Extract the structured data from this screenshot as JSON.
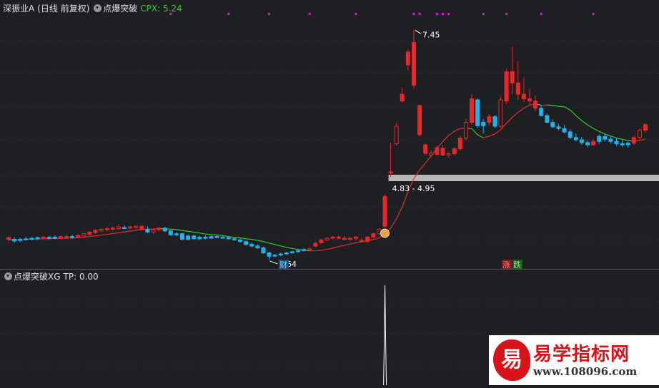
{
  "main_header": {
    "stock_name": "深振业A",
    "period": "(日线 前复权)",
    "indicator_name": "点爆突破",
    "indicator_value": "CPX: 5.24"
  },
  "sub_header": {
    "indicator_name": "点爆突破XG",
    "indicator_value": "TP: 0.00"
  },
  "annotations": {
    "high_label": "7.45",
    "low_label": "3.64",
    "range_label": "4.83 - 4.95",
    "cai_badge": "财",
    "zhang_badge": "涨",
    "die_badge": "跌"
  },
  "watermark": {
    "logo_char": "易",
    "title": "易学指标网",
    "url": "www.108096.com"
  },
  "colors": {
    "background": "#1e1f22",
    "up": "#e8262c",
    "down": "#21b1ec",
    "ma_up": "#e03030",
    "ma_down": "#33cc33",
    "signal_dot": "#d020d0",
    "grid": "#2e3035",
    "band": "#b8b8b8",
    "indicator_green": "#33cc33"
  },
  "chart_data": {
    "type": "candlestick",
    "price_range_visible": [
      3.2,
      7.7
    ],
    "grid": true,
    "candles": [
      {
        "o": 3.75,
        "h": 3.78,
        "l": 3.68,
        "c": 3.72,
        "d": "up"
      },
      {
        "o": 3.72,
        "h": 3.76,
        "l": 3.66,
        "c": 3.69,
        "d": "down"
      },
      {
        "o": 3.7,
        "h": 3.75,
        "l": 3.67,
        "c": 3.72,
        "d": "down"
      },
      {
        "o": 3.72,
        "h": 3.76,
        "l": 3.7,
        "c": 3.73,
        "d": "down"
      },
      {
        "o": 3.73,
        "h": 3.76,
        "l": 3.7,
        "c": 3.74,
        "d": "down"
      },
      {
        "o": 3.74,
        "h": 3.77,
        "l": 3.71,
        "c": 3.75,
        "d": "down"
      },
      {
        "o": 3.75,
        "h": 3.78,
        "l": 3.72,
        "c": 3.76,
        "d": "up"
      },
      {
        "o": 3.74,
        "h": 3.78,
        "l": 3.71,
        "c": 3.76,
        "d": "down"
      },
      {
        "o": 3.76,
        "h": 3.79,
        "l": 3.72,
        "c": 3.74,
        "d": "down"
      },
      {
        "o": 3.74,
        "h": 3.79,
        "l": 3.72,
        "c": 3.77,
        "d": "up"
      },
      {
        "o": 3.77,
        "h": 3.8,
        "l": 3.74,
        "c": 3.76,
        "d": "up"
      },
      {
        "o": 3.76,
        "h": 3.8,
        "l": 3.73,
        "c": 3.77,
        "d": "down"
      },
      {
        "o": 3.76,
        "h": 3.81,
        "l": 3.74,
        "c": 3.79,
        "d": "up"
      },
      {
        "o": 3.78,
        "h": 3.84,
        "l": 3.76,
        "c": 3.82,
        "d": "up"
      },
      {
        "o": 3.81,
        "h": 3.86,
        "l": 3.79,
        "c": 3.85,
        "d": "up"
      },
      {
        "o": 3.84,
        "h": 3.9,
        "l": 3.82,
        "c": 3.88,
        "d": "up"
      },
      {
        "o": 3.87,
        "h": 3.92,
        "l": 3.85,
        "c": 3.9,
        "d": "up"
      },
      {
        "o": 3.89,
        "h": 3.94,
        "l": 3.86,
        "c": 3.91,
        "d": "up"
      },
      {
        "o": 3.9,
        "h": 3.95,
        "l": 3.87,
        "c": 3.92,
        "d": "up"
      },
      {
        "o": 3.91,
        "h": 3.99,
        "l": 3.89,
        "c": 3.94,
        "d": "up"
      },
      {
        "o": 3.93,
        "h": 3.97,
        "l": 3.9,
        "c": 3.92,
        "d": "down"
      },
      {
        "o": 3.92,
        "h": 3.96,
        "l": 3.89,
        "c": 3.94,
        "d": "up"
      },
      {
        "o": 3.93,
        "h": 3.97,
        "l": 3.9,
        "c": 3.95,
        "d": "up"
      },
      {
        "o": 3.95,
        "h": 3.97,
        "l": 3.88,
        "c": 3.9,
        "d": "up"
      },
      {
        "o": 3.9,
        "h": 3.95,
        "l": 3.83,
        "c": 3.85,
        "d": "down"
      },
      {
        "o": 3.85,
        "h": 3.91,
        "l": 3.82,
        "c": 3.89,
        "d": "up"
      },
      {
        "o": 3.89,
        "h": 3.94,
        "l": 3.86,
        "c": 3.92,
        "d": "up"
      },
      {
        "o": 3.92,
        "h": 3.94,
        "l": 3.85,
        "c": 3.87,
        "d": "down"
      },
      {
        "o": 3.87,
        "h": 3.9,
        "l": 3.78,
        "c": 3.8,
        "d": "down"
      },
      {
        "o": 3.8,
        "h": 3.85,
        "l": 3.77,
        "c": 3.82,
        "d": "down"
      },
      {
        "o": 3.82,
        "h": 3.84,
        "l": 3.7,
        "c": 3.72,
        "d": "down"
      },
      {
        "o": 3.72,
        "h": 3.8,
        "l": 3.7,
        "c": 3.78,
        "d": "down"
      },
      {
        "o": 3.78,
        "h": 3.8,
        "l": 3.71,
        "c": 3.73,
        "d": "down"
      },
      {
        "o": 3.73,
        "h": 3.78,
        "l": 3.71,
        "c": 3.76,
        "d": "down"
      },
      {
        "o": 3.76,
        "h": 3.79,
        "l": 3.72,
        "c": 3.74,
        "d": "down"
      },
      {
        "o": 3.74,
        "h": 3.79,
        "l": 3.73,
        "c": 3.77,
        "d": "down"
      },
      {
        "o": 3.77,
        "h": 3.8,
        "l": 3.74,
        "c": 3.76,
        "d": "down"
      },
      {
        "o": 3.76,
        "h": 3.79,
        "l": 3.73,
        "c": 3.75,
        "d": "down"
      },
      {
        "o": 3.75,
        "h": 3.77,
        "l": 3.71,
        "c": 3.73,
        "d": "down"
      },
      {
        "o": 3.73,
        "h": 3.76,
        "l": 3.69,
        "c": 3.71,
        "d": "down"
      },
      {
        "o": 3.71,
        "h": 3.74,
        "l": 3.66,
        "c": 3.68,
        "d": "down"
      },
      {
        "o": 3.68,
        "h": 3.7,
        "l": 3.61,
        "c": 3.63,
        "d": "down"
      },
      {
        "o": 3.63,
        "h": 3.66,
        "l": 3.58,
        "c": 3.6,
        "d": "down"
      },
      {
        "o": 3.6,
        "h": 3.63,
        "l": 3.55,
        "c": 3.57,
        "d": "down"
      },
      {
        "o": 3.57,
        "h": 3.59,
        "l": 3.46,
        "c": 3.48,
        "d": "down"
      },
      {
        "o": 3.48,
        "h": 3.5,
        "l": 3.36,
        "c": 3.42,
        "d": "down"
      },
      {
        "o": 3.42,
        "h": 3.46,
        "l": 3.4,
        "c": 3.44,
        "d": "down"
      },
      {
        "o": 3.44,
        "h": 3.48,
        "l": 3.42,
        "c": 3.46,
        "d": "down"
      },
      {
        "o": 3.46,
        "h": 3.5,
        "l": 3.44,
        "c": 3.48,
        "d": "down"
      },
      {
        "o": 3.48,
        "h": 3.52,
        "l": 3.46,
        "c": 3.5,
        "d": "down"
      },
      {
        "o": 3.5,
        "h": 3.54,
        "l": 3.48,
        "c": 3.52,
        "d": "down"
      },
      {
        "o": 3.52,
        "h": 3.56,
        "l": 3.5,
        "c": 3.54,
        "d": "down"
      },
      {
        "o": 3.54,
        "h": 3.58,
        "l": 3.52,
        "c": 3.55,
        "d": "up"
      },
      {
        "o": 3.6,
        "h": 3.68,
        "l": 3.58,
        "c": 3.65,
        "d": "up"
      },
      {
        "o": 3.66,
        "h": 3.73,
        "l": 3.64,
        "c": 3.71,
        "d": "up"
      },
      {
        "o": 3.71,
        "h": 3.76,
        "l": 3.69,
        "c": 3.74,
        "d": "up"
      },
      {
        "o": 3.74,
        "h": 3.78,
        "l": 3.71,
        "c": 3.76,
        "d": "up"
      },
      {
        "o": 3.76,
        "h": 3.79,
        "l": 3.72,
        "c": 3.74,
        "d": "up"
      },
      {
        "o": 3.74,
        "h": 3.78,
        "l": 3.7,
        "c": 3.72,
        "d": "up"
      },
      {
        "o": 3.72,
        "h": 3.76,
        "l": 3.69,
        "c": 3.74,
        "d": "up"
      },
      {
        "o": 3.74,
        "h": 3.78,
        "l": 3.71,
        "c": 3.76,
        "d": "up"
      },
      {
        "o": 3.7,
        "h": 3.74,
        "l": 3.66,
        "c": 3.68,
        "d": "up"
      },
      {
        "o": 3.68,
        "h": 3.78,
        "l": 3.66,
        "c": 3.76,
        "d": "up"
      },
      {
        "o": 3.76,
        "h": 3.84,
        "l": 3.74,
        "c": 3.82,
        "d": "up"
      },
      {
        "o": 3.82,
        "h": 3.92,
        "l": 3.8,
        "c": 3.9,
        "d": "up"
      },
      {
        "o": 3.95,
        "h": 4.52,
        "l": 3.93,
        "c": 4.48,
        "d": "up"
      },
      {
        "o": 4.9,
        "h": 5.44,
        "l": 4.83,
        "c": 4.92,
        "d": "up"
      },
      {
        "o": 5.42,
        "h": 5.8,
        "l": 5.38,
        "c": 5.73,
        "d": "up"
      },
      {
        "o": 6.18,
        "h": 6.42,
        "l": 6.15,
        "c": 6.3,
        "d": "up"
      },
      {
        "o": 6.82,
        "h": 7.1,
        "l": 6.72,
        "c": 7.05,
        "d": "up"
      },
      {
        "o": 7.22,
        "h": 7.45,
        "l": 6.4,
        "c": 6.46,
        "d": "up"
      },
      {
        "o": 6.1,
        "h": 6.12,
        "l": 5.55,
        "c": 5.58,
        "d": "up"
      },
      {
        "o": 5.4,
        "h": 5.42,
        "l": 5.22,
        "c": 5.25,
        "d": "up"
      },
      {
        "o": 5.22,
        "h": 5.3,
        "l": 5.18,
        "c": 5.25,
        "d": "up"
      },
      {
        "o": 5.23,
        "h": 5.38,
        "l": 5.2,
        "c": 5.35,
        "d": "up"
      },
      {
        "o": 5.34,
        "h": 5.4,
        "l": 5.2,
        "c": 5.22,
        "d": "up"
      },
      {
        "o": 5.22,
        "h": 5.28,
        "l": 5.17,
        "c": 5.24,
        "d": "up"
      },
      {
        "o": 5.24,
        "h": 5.36,
        "l": 5.21,
        "c": 5.33,
        "d": "up"
      },
      {
        "o": 5.33,
        "h": 5.56,
        "l": 5.3,
        "c": 5.52,
        "d": "up"
      },
      {
        "o": 5.52,
        "h": 5.86,
        "l": 5.48,
        "c": 5.8,
        "d": "up"
      },
      {
        "o": 5.8,
        "h": 6.3,
        "l": 5.76,
        "c": 6.22,
        "d": "up"
      },
      {
        "o": 6.2,
        "h": 6.23,
        "l": 5.7,
        "c": 5.74,
        "d": "down"
      },
      {
        "o": 5.74,
        "h": 5.86,
        "l": 5.6,
        "c": 5.8,
        "d": "down"
      },
      {
        "o": 5.8,
        "h": 5.95,
        "l": 5.74,
        "c": 5.9,
        "d": "up"
      },
      {
        "o": 5.9,
        "h": 5.93,
        "l": 5.7,
        "c": 5.73,
        "d": "down"
      },
      {
        "o": 5.73,
        "h": 6.26,
        "l": 5.7,
        "c": 6.2,
        "d": "up"
      },
      {
        "o": 6.18,
        "h": 6.75,
        "l": 6.12,
        "c": 6.7,
        "d": "up"
      },
      {
        "o": 6.7,
        "h": 7.15,
        "l": 6.3,
        "c": 6.5,
        "d": "up"
      },
      {
        "o": 6.5,
        "h": 6.88,
        "l": 6.2,
        "c": 6.3,
        "d": "up"
      },
      {
        "o": 6.3,
        "h": 6.6,
        "l": 6.16,
        "c": 6.22,
        "d": "up"
      },
      {
        "o": 6.22,
        "h": 6.4,
        "l": 6.1,
        "c": 6.18,
        "d": "up"
      },
      {
        "o": 6.18,
        "h": 6.28,
        "l": 6.0,
        "c": 6.05,
        "d": "up"
      },
      {
        "o": 6.05,
        "h": 6.1,
        "l": 5.9,
        "c": 5.92,
        "d": "down"
      },
      {
        "o": 5.92,
        "h": 5.96,
        "l": 5.78,
        "c": 5.8,
        "d": "down"
      },
      {
        "o": 5.8,
        "h": 5.85,
        "l": 5.7,
        "c": 5.72,
        "d": "down"
      },
      {
        "o": 5.72,
        "h": 5.78,
        "l": 5.66,
        "c": 5.69,
        "d": "down"
      },
      {
        "o": 5.69,
        "h": 5.76,
        "l": 5.6,
        "c": 5.63,
        "d": "down"
      },
      {
        "o": 5.63,
        "h": 5.68,
        "l": 5.5,
        "c": 5.53,
        "d": "down"
      },
      {
        "o": 5.53,
        "h": 5.6,
        "l": 5.46,
        "c": 5.49,
        "d": "down"
      },
      {
        "o": 5.49,
        "h": 5.54,
        "l": 5.4,
        "c": 5.44,
        "d": "down"
      },
      {
        "o": 5.44,
        "h": 5.48,
        "l": 5.36,
        "c": 5.4,
        "d": "down"
      },
      {
        "o": 5.4,
        "h": 5.5,
        "l": 5.38,
        "c": 5.46,
        "d": "up"
      },
      {
        "o": 5.46,
        "h": 5.58,
        "l": 5.42,
        "c": 5.55,
        "d": "down"
      },
      {
        "o": 5.55,
        "h": 5.6,
        "l": 5.46,
        "c": 5.5,
        "d": "down"
      },
      {
        "o": 5.5,
        "h": 5.55,
        "l": 5.42,
        "c": 5.46,
        "d": "down"
      },
      {
        "o": 5.46,
        "h": 5.52,
        "l": 5.38,
        "c": 5.42,
        "d": "down"
      },
      {
        "o": 5.42,
        "h": 5.48,
        "l": 5.36,
        "c": 5.4,
        "d": "down"
      },
      {
        "o": 5.4,
        "h": 5.46,
        "l": 5.35,
        "c": 5.43,
        "d": "down"
      },
      {
        "o": 5.43,
        "h": 5.56,
        "l": 5.4,
        "c": 5.53,
        "d": "up"
      },
      {
        "o": 5.53,
        "h": 5.7,
        "l": 5.5,
        "c": 5.66,
        "d": "up"
      },
      {
        "o": 5.66,
        "h": 5.78,
        "l": 5.62,
        "c": 5.76,
        "d": "up"
      }
    ],
    "signal_dot_indices": [
      28,
      38,
      45,
      52,
      60,
      70,
      71,
      74,
      75,
      76,
      82,
      86,
      92,
      101
    ]
  },
  "sub_chart_data": {
    "type": "bar",
    "spike_index": 66,
    "ylim": [
      0,
      1
    ]
  }
}
